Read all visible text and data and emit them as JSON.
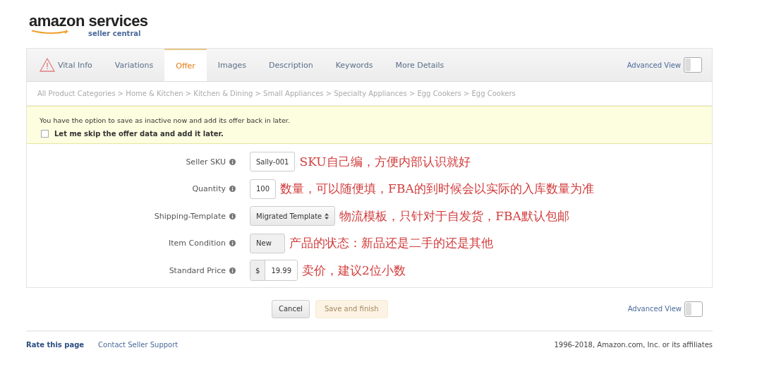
{
  "logo": {
    "wordmark": "amazon services",
    "subtitle": "seller central"
  },
  "tabs": [
    {
      "label": "Vital Info",
      "selected": false,
      "warning": true
    },
    {
      "label": "Variations",
      "selected": false,
      "warning": false
    },
    {
      "label": "Offer",
      "selected": true,
      "warning": false
    },
    {
      "label": "Images",
      "selected": false,
      "warning": false
    },
    {
      "label": "Description",
      "selected": false,
      "warning": false
    },
    {
      "label": "Keywords",
      "selected": false,
      "warning": false
    },
    {
      "label": "More Details",
      "selected": false,
      "warning": false
    }
  ],
  "advanced_view_top": {
    "label": "Advanced View",
    "on": false
  },
  "breadcrumb": "All Product Categories > Home & Kitchen > Kitchen & Dining > Small Appliances > Specialty Appliances > Egg Cookers > Egg Cookers",
  "notice": {
    "text": "You have the option to save as inactive now and add its offer back in later.",
    "checkbox": {
      "label": "Let me skip the offer data and add it later.",
      "checked": false
    }
  },
  "fields": [
    {
      "label": "Seller SKU",
      "kind": "input",
      "value": "Sally-001",
      "annotation": "SKU自己编，方便内部认识就好"
    },
    {
      "label": "Quantity",
      "kind": "input",
      "value": "100",
      "annotation": "数量，可以随便填，FBA的到时候会以实际的入库数量为准"
    },
    {
      "label": "Shipping-Template",
      "kind": "select",
      "value": "Migrated Template",
      "annotation": "物流模板，只针对于自发货，FBA默认包邮"
    },
    {
      "label": "Item Condition",
      "kind": "select-plain",
      "value": "New",
      "annotation": "产品的状态：新品还是二手的还是其他"
    },
    {
      "label": "Standard Price",
      "kind": "price",
      "prefix": "$",
      "value": "19.99",
      "annotation": "卖价，建议2位小数"
    }
  ],
  "buttons": [
    {
      "label": "Cancel",
      "disabled": false
    },
    {
      "label": "Save and finish",
      "disabled": true
    }
  ],
  "advanced_view_bottom": {
    "label": "Advanced View",
    "on": false
  },
  "footer": {
    "links": [
      "Rate this page",
      "Contact Seller Support"
    ],
    "copyright": "1996-2018, Amazon.com, Inc. or its affiliates"
  }
}
